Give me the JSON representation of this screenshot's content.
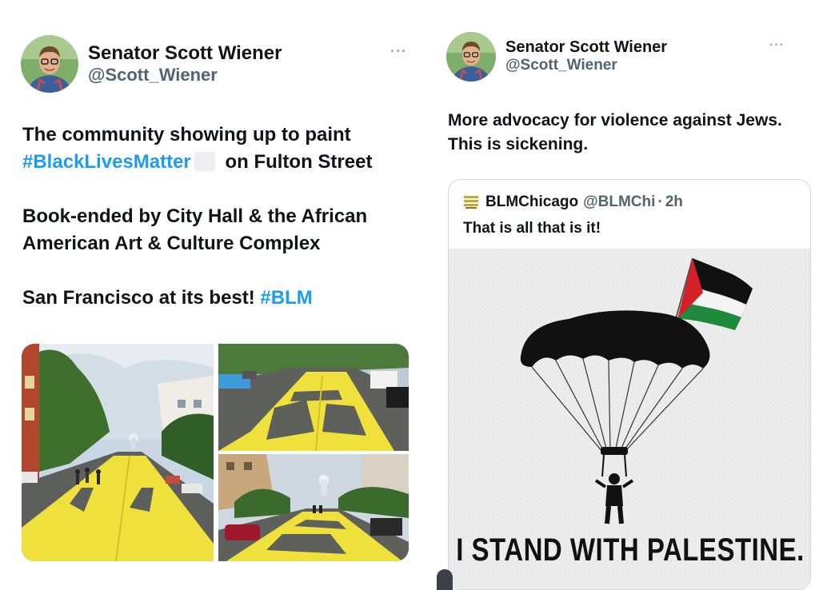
{
  "left_tweet": {
    "author": {
      "display_name": "Senator Scott Wiener",
      "handle": "@Scott_Wiener",
      "avatar": "avatar-icon"
    },
    "more_icon": "···",
    "paragraph_1": {
      "before": "The community showing up to paint ",
      "hashtag": "#BlackLivesMatter",
      "after": " on Fulton Street"
    },
    "paragraph_2": "Book-ended by City Hall & the African American Art & Culture Complex",
    "paragraph_3": {
      "text": "San Francisco at its best! ",
      "hashtag": "#BLM"
    },
    "photos": [
      "street-mural-photo",
      "street-mural-photo",
      "street-mural-photo"
    ]
  },
  "right_tweet": {
    "author": {
      "display_name": "Senator Scott Wiener",
      "handle": "@Scott_Wiener",
      "avatar": "avatar-icon"
    },
    "more_icon": "···",
    "text": "More advocacy for violence against Jews. This is sickening.",
    "quoted_tweet": {
      "display_name": "BLMChicago",
      "handle": "@BLMChi",
      "separator": "·",
      "time": "2h",
      "text": "That is all that is it!",
      "image_caption": "I STAND WITH PALESTINE."
    }
  },
  "colors": {
    "hashtag": "#1d9bf0",
    "text": "#0f1419",
    "secondary": "#536471",
    "paint_yellow": "#f2e43a"
  }
}
